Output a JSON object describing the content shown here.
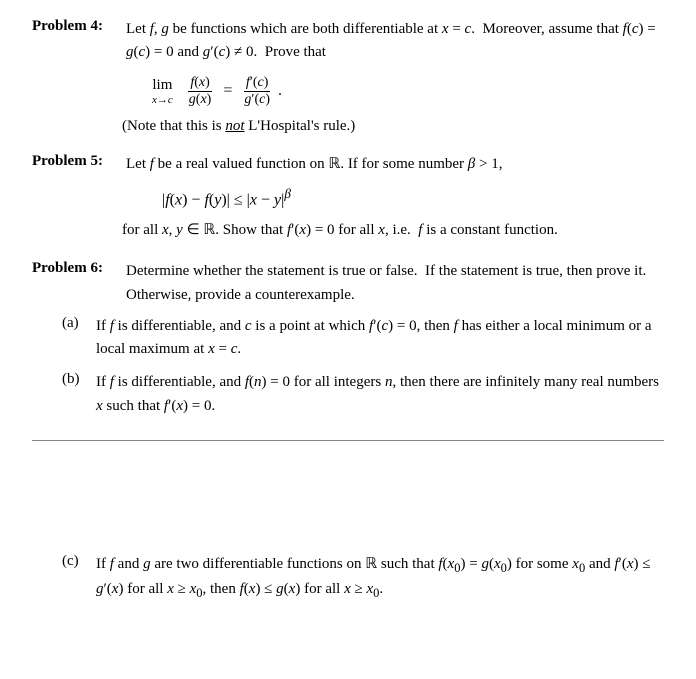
{
  "problems": [
    {
      "id": "problem4",
      "label": "Problem 4:",
      "intro": "Let f, g be functions which are both differentiable at x = c.  Moreover, assume that f(c) = g(c) = 0 and g′(c) ≠ 0.  Prove that",
      "formula_display": "lim f(x)/g(x) = f′(c)/g′(c).",
      "note": "(Note that this is not L'Hospital's rule.)"
    },
    {
      "id": "problem5",
      "label": "Problem 5:",
      "intro": "Let f be a real valued function on ℝ. If for some number β > 1,",
      "formula_display": "|f(x) − f(y)| ≤ |x − y|^β",
      "conclusion": "for all x, y ∈ ℝ. Show that f′(x) = 0 for all x, i.e.  f is a constant function."
    },
    {
      "id": "problem6",
      "label": "Problem 6:",
      "intro": "Determine whether the statement is true or false.  If the statement is true, then prove it.  Otherwise, provide a counterexample.",
      "parts": [
        {
          "label": "(a)",
          "text": "If f is differentiable, and c is a point at which f′(c) = 0, then f has either a local minimum or a local maximum at x = c."
        },
        {
          "label": "(b)",
          "text": "If f is differentiable, and f(n) = 0 for all integers n, then there are infinitely many real numbers x such that f′(x) = 0."
        },
        {
          "label": "(c)",
          "text": "If f and g are two differentiable functions on ℝ such that f(x₀) = g(x₀) for some x₀ and f′(x) ≤ g′(x) for all x ≥ x₀, then f(x) ≤ g(x) for all x ≥ x₀."
        }
      ]
    }
  ],
  "divider_position": "after_part_b"
}
